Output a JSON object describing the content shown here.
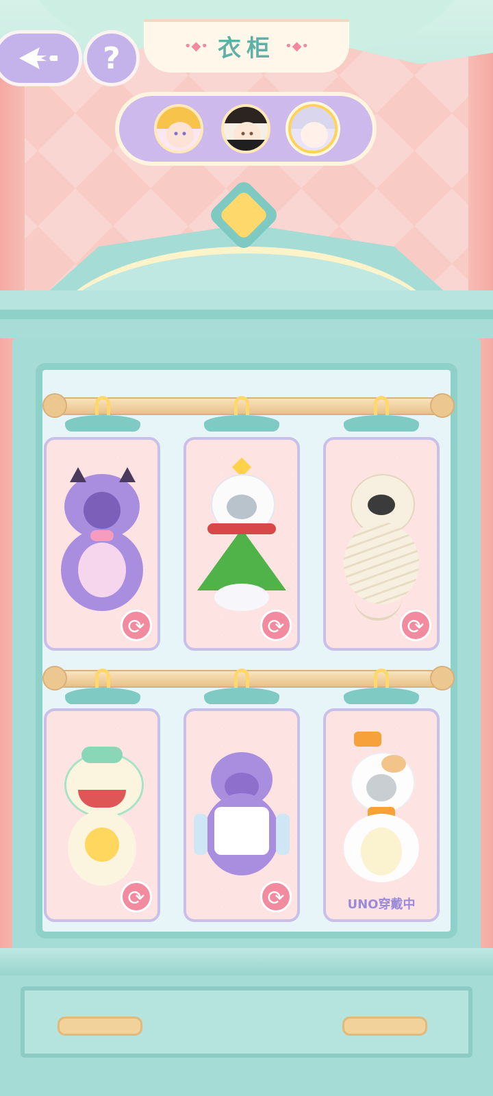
{
  "header": {
    "title": "衣柜",
    "title_deco_left": "•◆•",
    "title_deco_right": "•◆•",
    "help_label": "?"
  },
  "icons": {
    "back": "back-arrow-icon",
    "help": "question-icon",
    "swap": "swap-arrows-icon",
    "swap_glyph": "⟳"
  },
  "characters": [
    {
      "name": "blonde-girl"
    },
    {
      "name": "brown-hair-girl-black-hat"
    },
    {
      "name": "silver-hair-girl",
      "selected": true
    }
  ],
  "costumes": [
    {
      "theme": "purple-devil",
      "status": "swap"
    },
    {
      "theme": "christmas-tree-snowman",
      "status": "swap"
    },
    {
      "theme": "mummy",
      "status": "swap"
    },
    {
      "theme": "lion-dance",
      "status": "swap"
    },
    {
      "theme": "purple-hamster",
      "status": "swap"
    },
    {
      "theme": "white-cat-bow",
      "status": "wearing",
      "status_text": "UNO穿戴中"
    }
  ],
  "colors": {
    "accent_purple": "#c4b2ea",
    "wardrobe_teal": "#a6dcd6",
    "swap_pink": "#f28aa0",
    "wearing_text": "#9a8ad8"
  }
}
